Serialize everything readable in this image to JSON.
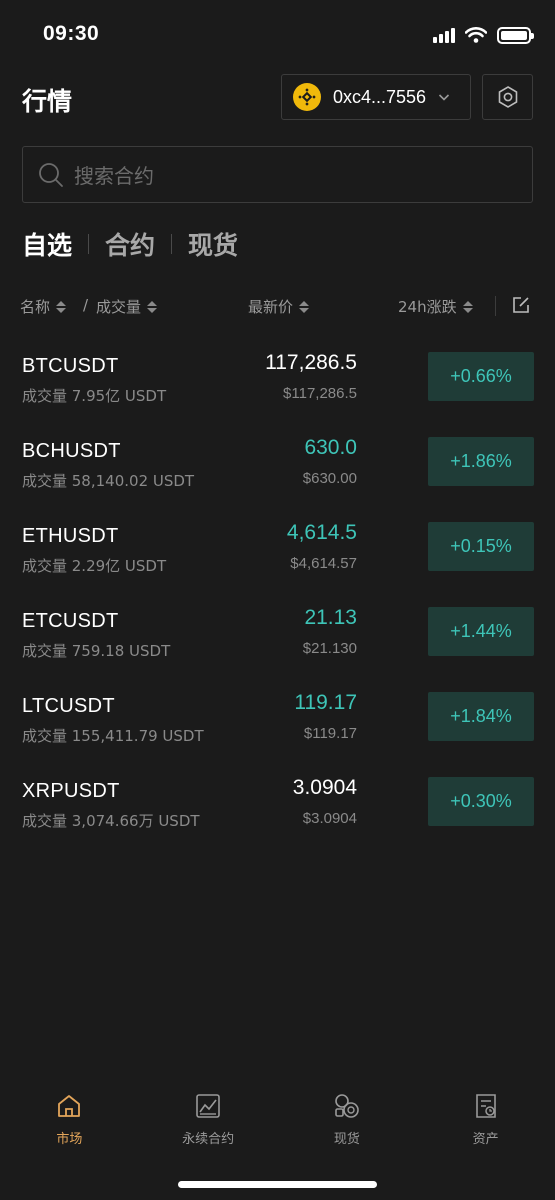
{
  "status_bar": {
    "time": "09:30"
  },
  "header": {
    "title": "行情",
    "wallet_address": "0xc4...7556",
    "wallet_icon": "bnb-coin-icon",
    "settings_icon": "hexagon-settings-icon"
  },
  "search": {
    "placeholder": "搜索合约"
  },
  "tabs": [
    {
      "label": "自选",
      "active": true
    },
    {
      "label": "合约",
      "active": false
    },
    {
      "label": "现货",
      "active": false
    }
  ],
  "columns": {
    "name": "名称",
    "separator": "/",
    "volume": "成交量",
    "last_price": "最新价",
    "change_24h": "24h涨跌"
  },
  "rows": [
    {
      "symbol": "BTCUSDT",
      "volume": "成交量 7.95亿 USDT",
      "price": "117,286.5",
      "price_up": false,
      "usd": "$117,286.5",
      "change": "+0.66%"
    },
    {
      "symbol": "BCHUSDT",
      "volume": "成交量 58,140.02 USDT",
      "price": "630.0",
      "price_up": true,
      "usd": "$630.00",
      "change": "+1.86%"
    },
    {
      "symbol": "ETHUSDT",
      "volume": "成交量 2.29亿 USDT",
      "price": "4,614.5",
      "price_up": true,
      "usd": "$4,614.57",
      "change": "+0.15%"
    },
    {
      "symbol": "ETCUSDT",
      "volume": "成交量 759.18 USDT",
      "price": "21.13",
      "price_up": true,
      "usd": "$21.130",
      "change": "+1.44%"
    },
    {
      "symbol": "LTCUSDT",
      "volume": "成交量 155,411.79 USDT",
      "price": "119.17",
      "price_up": true,
      "usd": "$119.17",
      "change": "+1.84%"
    },
    {
      "symbol": "XRPUSDT",
      "volume": "成交量 3,074.66万 USDT",
      "price": "3.0904",
      "price_up": false,
      "usd": "$3.0904",
      "change": "+0.30%"
    }
  ],
  "bottom_nav": [
    {
      "label": "市场",
      "icon": "home-icon",
      "active": true
    },
    {
      "label": "永续合约",
      "icon": "chart-icon",
      "active": false
    },
    {
      "label": "现货",
      "icon": "coins-icon",
      "active": false
    },
    {
      "label": "资产",
      "icon": "wallet-doc-icon",
      "active": false
    }
  ],
  "colors": {
    "background": "#1b1b1b",
    "up": "#3ec5b8",
    "up_bg": "#1f3c37",
    "accent": "#e3a55a",
    "bnb": "#f0b90b"
  }
}
